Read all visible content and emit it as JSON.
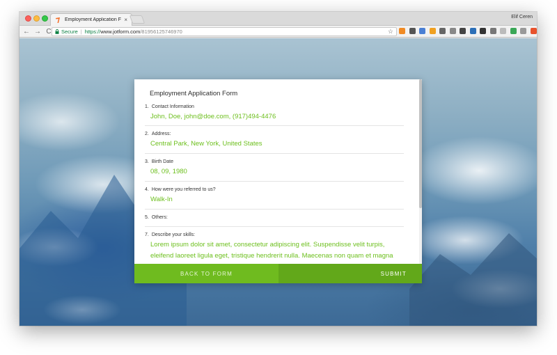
{
  "browser": {
    "tab_title": "Employment Application Form",
    "tab_close": "×",
    "profile_name": "Elif Ceren",
    "nav": {
      "back": "←",
      "forward": "→",
      "reload": "C"
    },
    "address": {
      "secure_label": "Secure",
      "separator": "|",
      "scheme": "https://",
      "host": "www.jotform.com",
      "path": "/81956125746970"
    },
    "star": "☆",
    "menu": "⋮",
    "extensions": [
      {
        "name": "extension-orange-icon",
        "color": "#f08a24"
      },
      {
        "name": "extension-shield-icon",
        "color": "#555555"
      },
      {
        "name": "extension-window-icon",
        "color": "#4a7fd4"
      },
      {
        "name": "extension-smiley-icon",
        "color": "#f0a020"
      },
      {
        "name": "extension-mail-icon",
        "color": "#666666"
      },
      {
        "name": "extension-code-icon",
        "color": "#888888"
      },
      {
        "name": "extension-chat-icon",
        "color": "#444444"
      },
      {
        "name": "extension-m-icon",
        "color": "#2c6fb7"
      },
      {
        "name": "extension-pocket-icon",
        "color": "#333333"
      },
      {
        "name": "extension-box-icon",
        "color": "#777777"
      },
      {
        "name": "extension-light-icon",
        "color": "#bbbbbb"
      },
      {
        "name": "extension-chrome-icon",
        "color": "#3aa757"
      },
      {
        "name": "extension-tablet-icon",
        "color": "#999999"
      },
      {
        "name": "extension-calendar-icon",
        "color": "#e8522c"
      },
      {
        "name": "extension-grid-icon",
        "color": "#aaaaaa"
      }
    ]
  },
  "form": {
    "title": "Employment Application Form",
    "fields": [
      {
        "num": "1.",
        "label": "Contact Information",
        "value": "John, Doe, john@doe.com, (917)494-4476"
      },
      {
        "num": "2.",
        "label": "Address:",
        "value": "Central Park, New York, United States"
      },
      {
        "num": "3.",
        "label": "Birth Date",
        "value": "08, 09, 1980"
      },
      {
        "num": "4.",
        "label": "How were you referred to us?",
        "value": "Walk-In"
      },
      {
        "num": "5.",
        "label": "Others:",
        "value": ""
      },
      {
        "num": "7.",
        "label": "Describe your skills:",
        "lines": [
          "Lorem ipsum dolor sit amet, consectetur adipiscing elit. Suspendisse velit turpis,",
          "eleifend laoreet ligula eget, tristique hendrerit nulla. Maecenas non quam et magna"
        ]
      }
    ],
    "back_label": "BACK TO FORM",
    "submit_label": "SUBMIT"
  }
}
